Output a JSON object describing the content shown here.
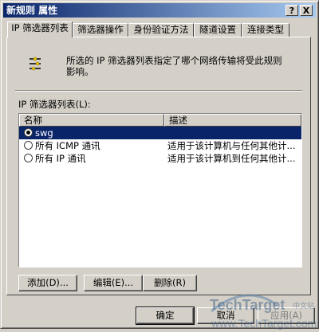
{
  "window": {
    "title": "新规则 属性",
    "help_btn": "?",
    "close_btn": "X"
  },
  "tabs": [
    {
      "label": "IP 筛选器列表",
      "active": true
    },
    {
      "label": "筛选器操作",
      "active": false
    },
    {
      "label": "身份验证方法",
      "active": false
    },
    {
      "label": "隧道设置",
      "active": false
    },
    {
      "label": "连接类型",
      "active": false
    }
  ],
  "panel": {
    "description_line1": "所选的 IP 筛选器列表指定了哪个网络传输将受此规则",
    "description_line2": "影响。",
    "list_label": "IP 筛选器列表(L):",
    "columns": [
      "名称",
      "描述"
    ],
    "rows": [
      {
        "name": "swg",
        "description": "",
        "checked": true,
        "selected": true
      },
      {
        "name": "所有 ICMP 通讯",
        "description": "适用于该计算机与任何其他计...",
        "checked": false,
        "selected": false
      },
      {
        "name": "所有 IP 通讯",
        "description": "适用于该计算机到任何其他计...",
        "checked": false,
        "selected": false
      }
    ],
    "buttons": {
      "add": "添加(D)...",
      "edit": "编辑(E)...",
      "remove": "删除(R)"
    }
  },
  "footer": {
    "ok": "确定",
    "cancel": "取消",
    "apply": "应用(A)"
  },
  "watermark": {
    "brand": "TechTarget",
    "cn": "中文站",
    "url": "www.TechTarget.com.cn"
  },
  "colors": {
    "face": "#d4d0c8",
    "title_start": "#0a246a",
    "title_end": "#a6caf0",
    "selection": "#0a246a"
  }
}
